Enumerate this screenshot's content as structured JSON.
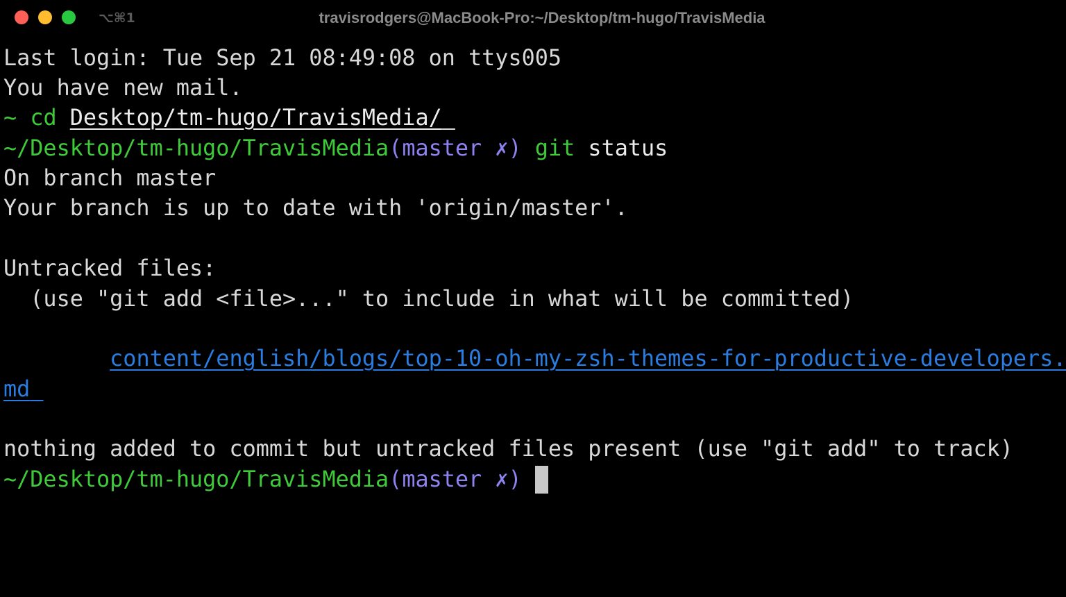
{
  "window": {
    "title": "travisrodgers@MacBook-Pro:~/Desktop/tm-hugo/TravisMedia",
    "shortcut": "⌥⌘1",
    "colors": {
      "close": "#fe5f57",
      "minimize": "#febc2e",
      "maximize": "#28c840"
    }
  },
  "terminal": {
    "last_login": "Last login: Tue Sep 21 08:49:08 on ttys005",
    "new_mail": "You have new mail.",
    "prompt1": {
      "symbol": "~",
      "command": "cd",
      "argument": "Desktop/tm-hugo/TravisMedia/"
    },
    "prompt2": {
      "path": "~/Desktop/tm-hugo/TravisMedia",
      "git_open": "(",
      "branch": "master",
      "dirty": "✗",
      "git_close": ")",
      "command": "git",
      "argument": "status"
    },
    "output": {
      "on_branch": "On branch master",
      "up_to_date": "Your branch is up to date with 'origin/master'.",
      "untracked_header": "Untracked files:",
      "hint": "  (use \"git add <file>...\" to include in what will be committed)",
      "file_part1": "content/english/blogs/top-10-oh-my-zsh-themes-for-productive-developers.",
      "file_part2": "md",
      "footer": "nothing added to commit but untracked files present (use \"git add\" to track)"
    },
    "prompt3": {
      "path": "~/Desktop/tm-hugo/TravisMedia",
      "git_open": "(",
      "branch": "master",
      "dirty": "✗",
      "git_close": ")"
    },
    "colors": {
      "background": "#000000",
      "text": "#d8d8d8",
      "green": "#3fcb39",
      "purple": "#8c82f0",
      "link": "#2a7de0",
      "cursor": "#c8c8c8"
    }
  }
}
